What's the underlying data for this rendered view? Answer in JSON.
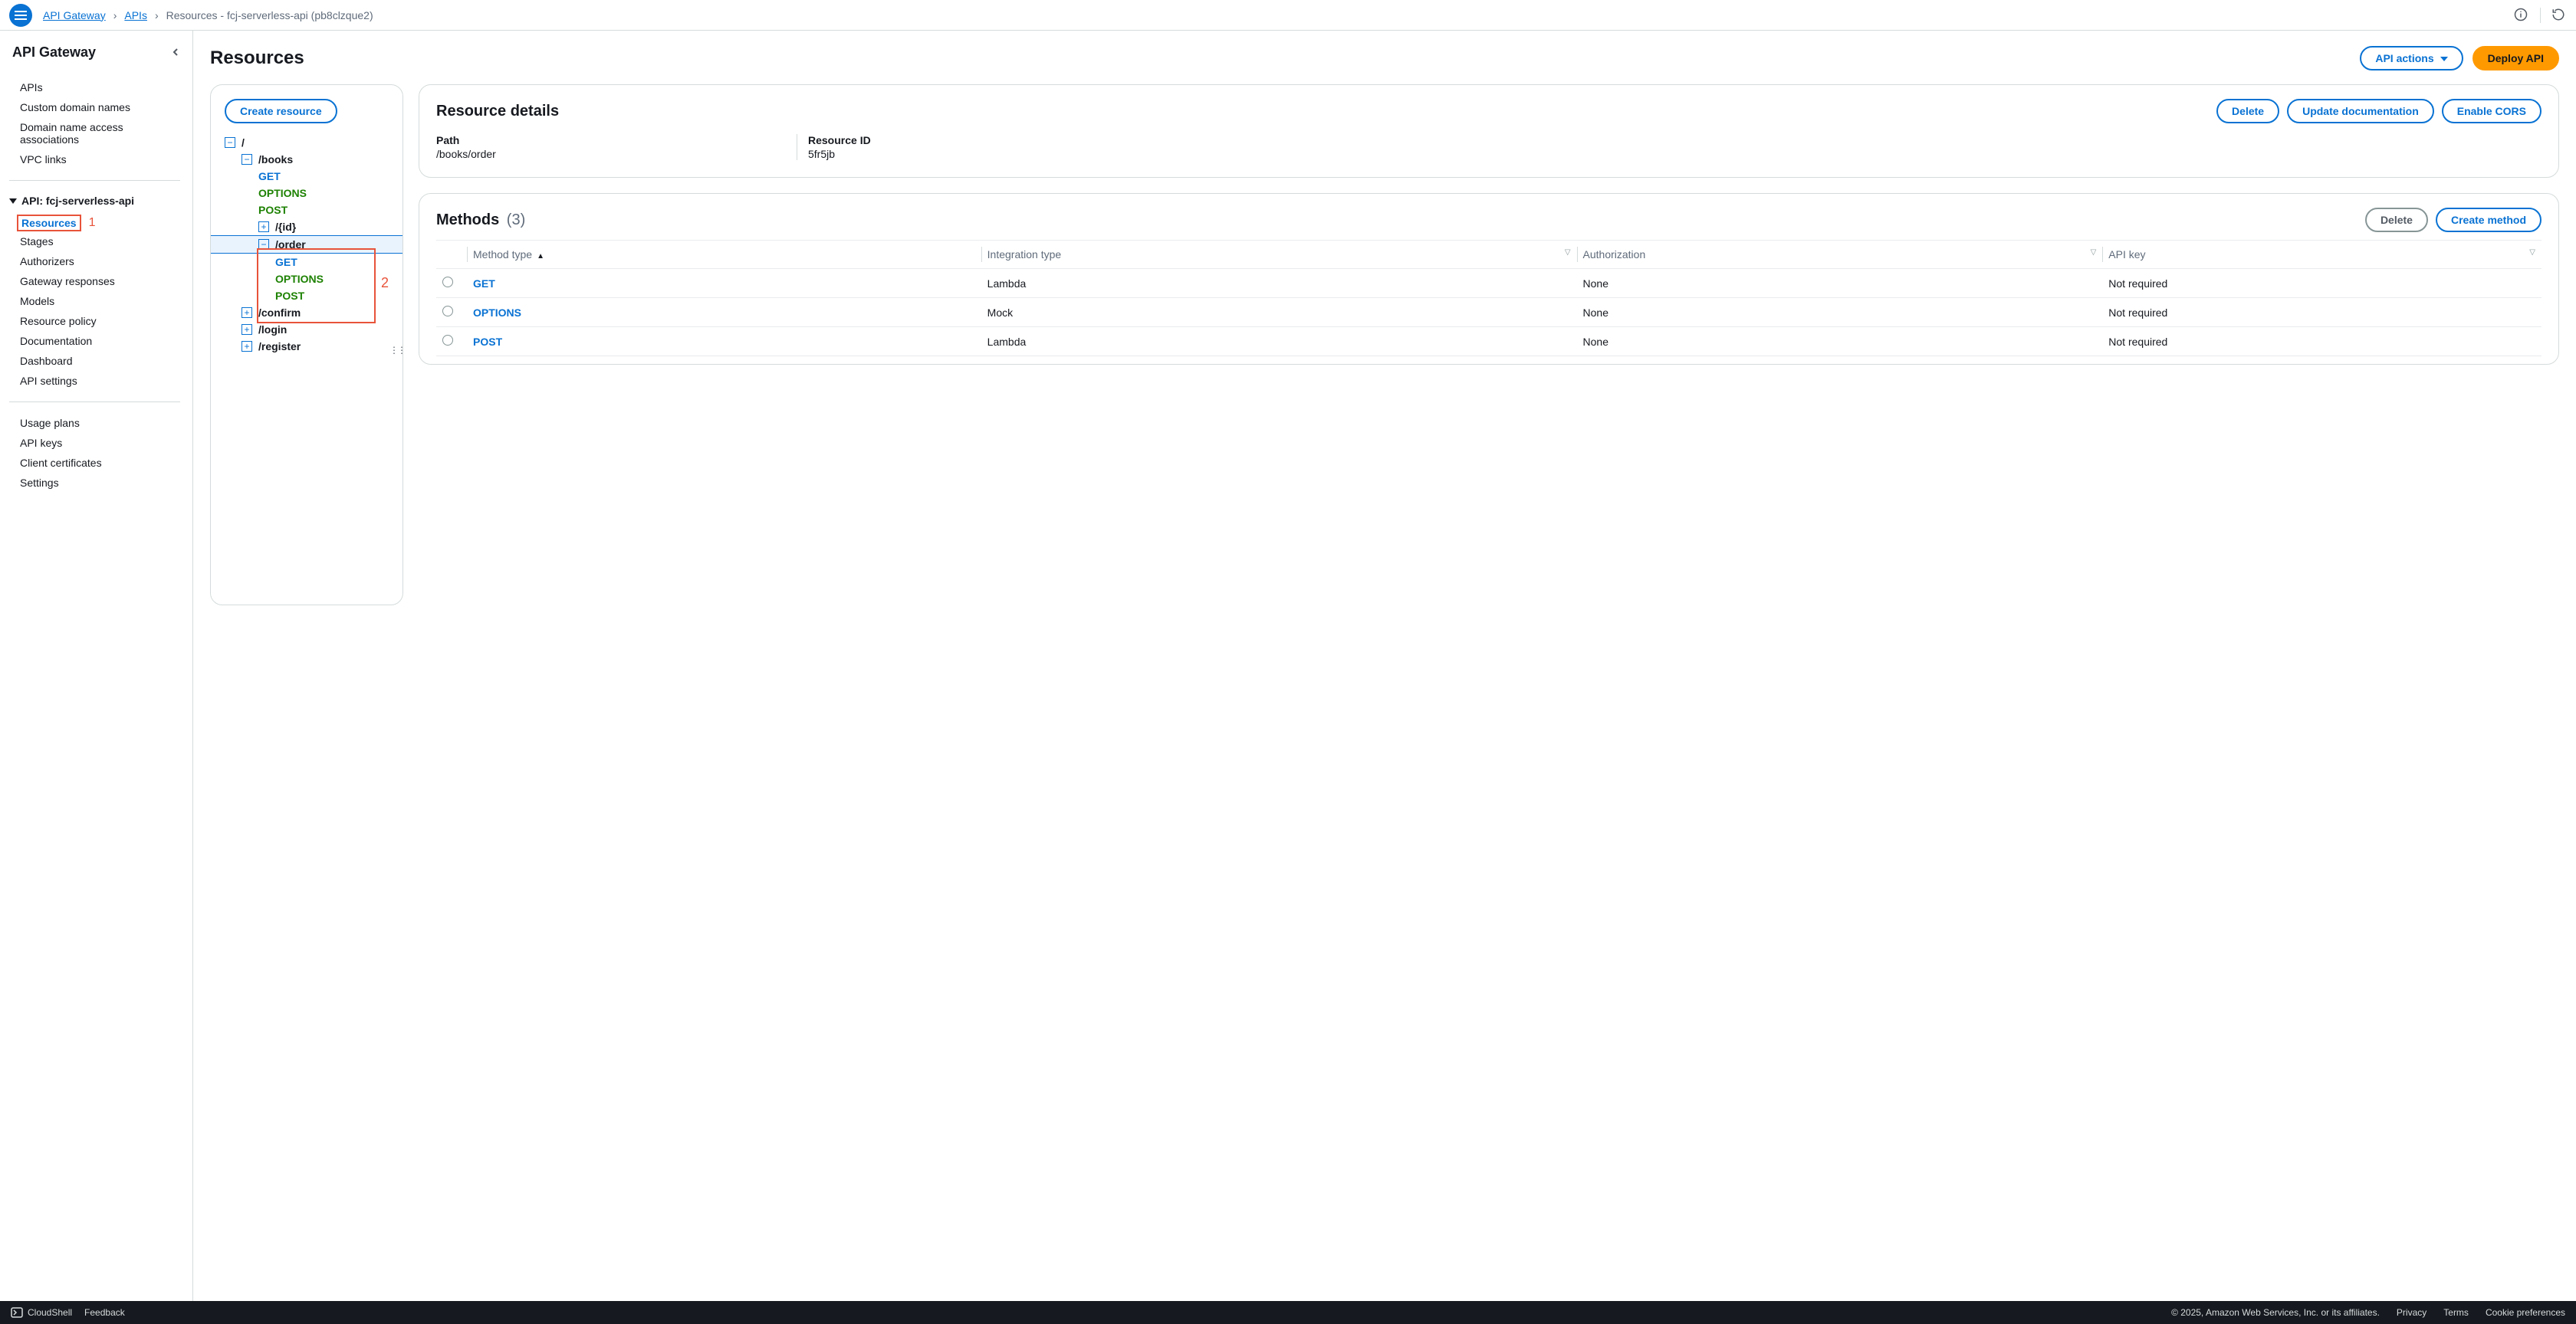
{
  "breadcrumb": {
    "root": "API Gateway",
    "mid": "APIs",
    "current": "Resources - fcj-serverless-api (pb8clzque2)"
  },
  "sidebar": {
    "title": "API Gateway",
    "group1": [
      "APIs",
      "Custom domain names",
      "Domain name access associations",
      "VPC links"
    ],
    "apiLabel": "API: fcj-serverless-api",
    "group2": [
      "Resources",
      "Stages",
      "Authorizers",
      "Gateway responses",
      "Models",
      "Resource policy",
      "Documentation",
      "Dashboard",
      "API settings"
    ],
    "group3": [
      "Usage plans",
      "API keys",
      "Client certificates",
      "Settings"
    ]
  },
  "page": {
    "title": "Resources",
    "apiActions": "API actions",
    "deploy": "Deploy API"
  },
  "tree": {
    "createResource": "Create resource",
    "root": "/",
    "books": "/books",
    "get": "GET",
    "options": "OPTIONS",
    "post": "POST",
    "id": "/{id}",
    "order": "/order",
    "confirm": "/confirm",
    "login": "/login",
    "register": "/register"
  },
  "annot": {
    "one": "1",
    "two": "2"
  },
  "details": {
    "title": "Resource details",
    "delete": "Delete",
    "updateDoc": "Update documentation",
    "enableCors": "Enable CORS",
    "pathLabel": "Path",
    "pathValue": "/books/order",
    "idLabel": "Resource ID",
    "idValue": "5fr5jb"
  },
  "methods": {
    "title": "Methods",
    "count": "(3)",
    "delete": "Delete",
    "create": "Create method",
    "cols": {
      "type": "Method type",
      "integration": "Integration type",
      "auth": "Authorization",
      "apikey": "API key"
    },
    "rows": [
      {
        "type": "GET",
        "integration": "Lambda",
        "auth": "None",
        "apikey": "Not required"
      },
      {
        "type": "OPTIONS",
        "integration": "Mock",
        "auth": "None",
        "apikey": "Not required"
      },
      {
        "type": "POST",
        "integration": "Lambda",
        "auth": "None",
        "apikey": "Not required"
      }
    ]
  },
  "footer": {
    "cloudshell": "CloudShell",
    "feedback": "Feedback",
    "copyright": "© 2025, Amazon Web Services, Inc. or its affiliates.",
    "privacy": "Privacy",
    "terms": "Terms",
    "cookies": "Cookie preferences"
  }
}
